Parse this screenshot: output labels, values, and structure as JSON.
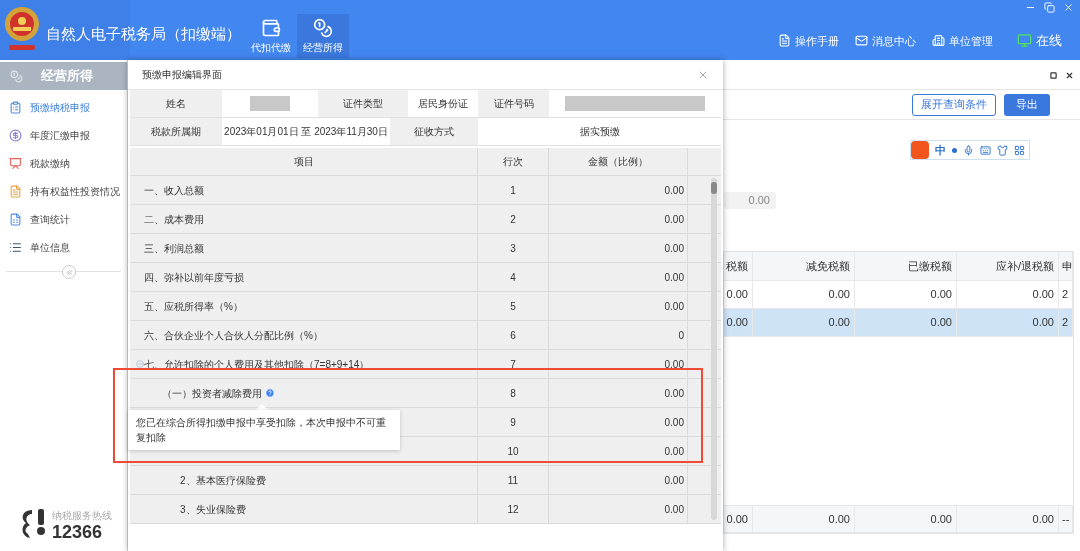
{
  "app": {
    "title": "自然人电子税务局（扣缴端）"
  },
  "nav_tabs": [
    {
      "label": "代扣代缴",
      "selected": false
    },
    {
      "label": "经营所得",
      "selected": true
    }
  ],
  "header_links": [
    {
      "label": "操作手册",
      "kind": "manual"
    },
    {
      "label": "消息中心",
      "kind": "message"
    },
    {
      "label": "单位管理",
      "kind": "company"
    },
    {
      "label": "在线",
      "kind": "online"
    }
  ],
  "sidebar": {
    "title": "经营所得",
    "items": [
      {
        "label": "预缴纳税申报",
        "selected": true,
        "kind": "declare"
      },
      {
        "label": "年度汇缴申报",
        "selected": false,
        "kind": "annual"
      },
      {
        "label": "税款缴纳",
        "selected": false,
        "kind": "pay"
      },
      {
        "label": "持有权益性投资情况",
        "selected": false,
        "kind": "invest"
      },
      {
        "label": "查询统计",
        "selected": false,
        "kind": "stats"
      },
      {
        "label": "单位信息",
        "selected": false,
        "kind": "info"
      }
    ],
    "hotline": {
      "label": "纳税服务热线",
      "number": "12366"
    }
  },
  "main": {
    "buttons": [
      {
        "label": "展开查询条件",
        "kind": "outline"
      },
      {
        "label": "导出",
        "kind": "primary"
      }
    ],
    "ime_toolbar": {
      "label": "中"
    },
    "amount_field": {
      "value": "0.00"
    },
    "table": {
      "columns": [
        "税额",
        "减免税额",
        "已缴税额",
        "应补/退税额",
        "申"
      ],
      "rows": [
        {
          "cells": [
            "0.00",
            "0.00",
            "0.00",
            "0.00",
            "2"
          ],
          "selected": false
        },
        {
          "cells": [
            "0.00",
            "0.00",
            "0.00",
            "0.00",
            "2"
          ],
          "selected": true
        }
      ],
      "total_row": [
        "0.00",
        "0.00",
        "0.00",
        "0.00",
        "--"
      ]
    }
  },
  "dialog": {
    "title": "预缴申报编辑界面",
    "info_rows": [
      [
        {
          "kind": "label",
          "text": "姓名"
        },
        {
          "kind": "redacted"
        },
        {
          "kind": "label",
          "text": "证件类型"
        },
        {
          "kind": "value",
          "text": "居民身份证"
        },
        {
          "kind": "label",
          "text": "证件号码"
        },
        {
          "kind": "redacted"
        }
      ],
      [
        {
          "kind": "label",
          "text": "税款所属期"
        },
        {
          "kind": "value",
          "text": "2023年01月01日 至 2023年11月30日"
        },
        {
          "kind": "label",
          "text": "征收方式"
        },
        {
          "kind": "value",
          "text": "据实预缴"
        }
      ]
    ],
    "grid": {
      "columns": [
        "项目",
        "行次",
        "金额（比例）"
      ],
      "rows": [
        {
          "item": "一、收入总额",
          "line": "1",
          "amount": "0.00"
        },
        {
          "item": "二、成本费用",
          "line": "2",
          "amount": "0.00"
        },
        {
          "item": "三、利润总额",
          "line": "3",
          "amount": "0.00"
        },
        {
          "item": "四、弥补以前年度亏损",
          "line": "4",
          "amount": "0.00"
        },
        {
          "item": "五、应税所得率（%）",
          "line": "5",
          "amount": "0.00"
        },
        {
          "item": "六、合伙企业个人合伙人分配比例（%）",
          "line": "6",
          "amount": "0"
        },
        {
          "item": "七、允许扣除的个人费用及其他扣除（7=8+9+14）",
          "line": "7",
          "amount": "0.00",
          "expanded": true,
          "children": [
            {
              "item": "（一）投资者减除费用",
              "line": "8",
              "amount": "0.00",
              "help": true
            },
            {
              "line": "9",
              "amount": "0.00",
              "children": [
                {
                  "line": "10",
                  "amount": "0.00"
                },
                {
                  "item": "2、基本医疗保险费",
                  "line": "11",
                  "amount": "0.00"
                },
                {
                  "item": "3、失业保险费",
                  "line": "12",
                  "amount": "0.00"
                }
              ]
            }
          ]
        }
      ]
    },
    "tooltip": {
      "text": "您已在综合所得扣缴申报中享受扣除，本次申报中不可重复扣除"
    }
  }
}
